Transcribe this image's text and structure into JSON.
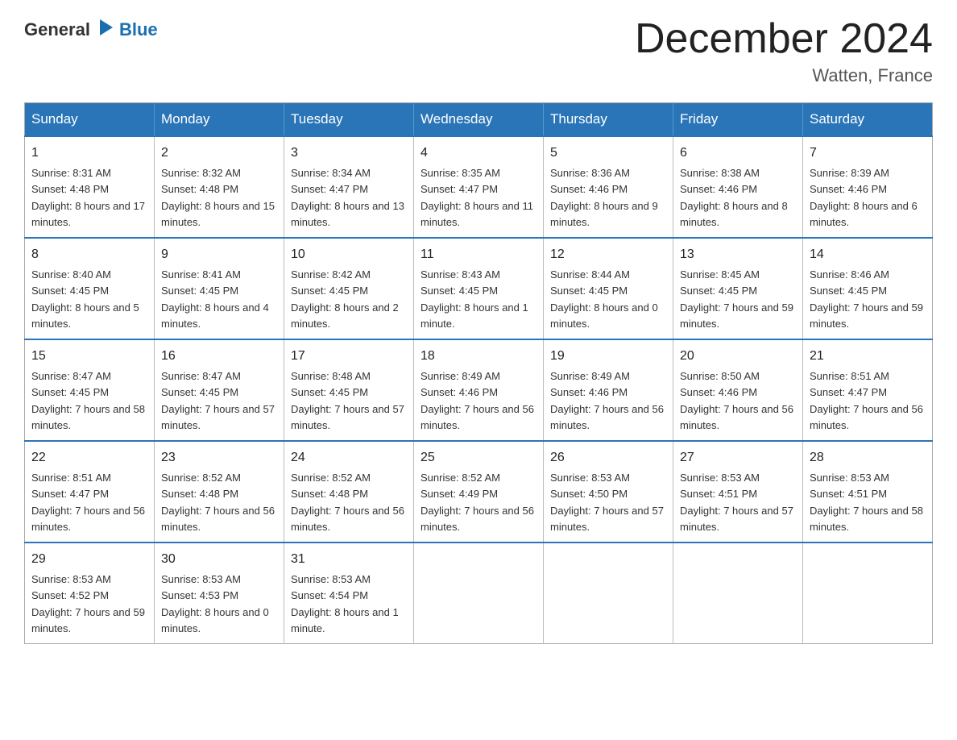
{
  "header": {
    "logo": {
      "general": "General",
      "arrow_icon": "▶",
      "blue": "Blue"
    },
    "title": "December 2024",
    "location": "Watten, France"
  },
  "calendar": {
    "days_of_week": [
      "Sunday",
      "Monday",
      "Tuesday",
      "Wednesday",
      "Thursday",
      "Friday",
      "Saturday"
    ],
    "weeks": [
      [
        {
          "day": "1",
          "sunrise": "8:31 AM",
          "sunset": "4:48 PM",
          "daylight": "8 hours and 17 minutes."
        },
        {
          "day": "2",
          "sunrise": "8:32 AM",
          "sunset": "4:48 PM",
          "daylight": "8 hours and 15 minutes."
        },
        {
          "day": "3",
          "sunrise": "8:34 AM",
          "sunset": "4:47 PM",
          "daylight": "8 hours and 13 minutes."
        },
        {
          "day": "4",
          "sunrise": "8:35 AM",
          "sunset": "4:47 PM",
          "daylight": "8 hours and 11 minutes."
        },
        {
          "day": "5",
          "sunrise": "8:36 AM",
          "sunset": "4:46 PM",
          "daylight": "8 hours and 9 minutes."
        },
        {
          "day": "6",
          "sunrise": "8:38 AM",
          "sunset": "4:46 PM",
          "daylight": "8 hours and 8 minutes."
        },
        {
          "day": "7",
          "sunrise": "8:39 AM",
          "sunset": "4:46 PM",
          "daylight": "8 hours and 6 minutes."
        }
      ],
      [
        {
          "day": "8",
          "sunrise": "8:40 AM",
          "sunset": "4:45 PM",
          "daylight": "8 hours and 5 minutes."
        },
        {
          "day": "9",
          "sunrise": "8:41 AM",
          "sunset": "4:45 PM",
          "daylight": "8 hours and 4 minutes."
        },
        {
          "day": "10",
          "sunrise": "8:42 AM",
          "sunset": "4:45 PM",
          "daylight": "8 hours and 2 minutes."
        },
        {
          "day": "11",
          "sunrise": "8:43 AM",
          "sunset": "4:45 PM",
          "daylight": "8 hours and 1 minute."
        },
        {
          "day": "12",
          "sunrise": "8:44 AM",
          "sunset": "4:45 PM",
          "daylight": "8 hours and 0 minutes."
        },
        {
          "day": "13",
          "sunrise": "8:45 AM",
          "sunset": "4:45 PM",
          "daylight": "7 hours and 59 minutes."
        },
        {
          "day": "14",
          "sunrise": "8:46 AM",
          "sunset": "4:45 PM",
          "daylight": "7 hours and 59 minutes."
        }
      ],
      [
        {
          "day": "15",
          "sunrise": "8:47 AM",
          "sunset": "4:45 PM",
          "daylight": "7 hours and 58 minutes."
        },
        {
          "day": "16",
          "sunrise": "8:47 AM",
          "sunset": "4:45 PM",
          "daylight": "7 hours and 57 minutes."
        },
        {
          "day": "17",
          "sunrise": "8:48 AM",
          "sunset": "4:45 PM",
          "daylight": "7 hours and 57 minutes."
        },
        {
          "day": "18",
          "sunrise": "8:49 AM",
          "sunset": "4:46 PM",
          "daylight": "7 hours and 56 minutes."
        },
        {
          "day": "19",
          "sunrise": "8:49 AM",
          "sunset": "4:46 PM",
          "daylight": "7 hours and 56 minutes."
        },
        {
          "day": "20",
          "sunrise": "8:50 AM",
          "sunset": "4:46 PM",
          "daylight": "7 hours and 56 minutes."
        },
        {
          "day": "21",
          "sunrise": "8:51 AM",
          "sunset": "4:47 PM",
          "daylight": "7 hours and 56 minutes."
        }
      ],
      [
        {
          "day": "22",
          "sunrise": "8:51 AM",
          "sunset": "4:47 PM",
          "daylight": "7 hours and 56 minutes."
        },
        {
          "day": "23",
          "sunrise": "8:52 AM",
          "sunset": "4:48 PM",
          "daylight": "7 hours and 56 minutes."
        },
        {
          "day": "24",
          "sunrise": "8:52 AM",
          "sunset": "4:48 PM",
          "daylight": "7 hours and 56 minutes."
        },
        {
          "day": "25",
          "sunrise": "8:52 AM",
          "sunset": "4:49 PM",
          "daylight": "7 hours and 56 minutes."
        },
        {
          "day": "26",
          "sunrise": "8:53 AM",
          "sunset": "4:50 PM",
          "daylight": "7 hours and 57 minutes."
        },
        {
          "day": "27",
          "sunrise": "8:53 AM",
          "sunset": "4:51 PM",
          "daylight": "7 hours and 57 minutes."
        },
        {
          "day": "28",
          "sunrise": "8:53 AM",
          "sunset": "4:51 PM",
          "daylight": "7 hours and 58 minutes."
        }
      ],
      [
        {
          "day": "29",
          "sunrise": "8:53 AM",
          "sunset": "4:52 PM",
          "daylight": "7 hours and 59 minutes."
        },
        {
          "day": "30",
          "sunrise": "8:53 AM",
          "sunset": "4:53 PM",
          "daylight": "8 hours and 0 minutes."
        },
        {
          "day": "31",
          "sunrise": "8:53 AM",
          "sunset": "4:54 PM",
          "daylight": "8 hours and 1 minute."
        },
        null,
        null,
        null,
        null
      ]
    ]
  }
}
